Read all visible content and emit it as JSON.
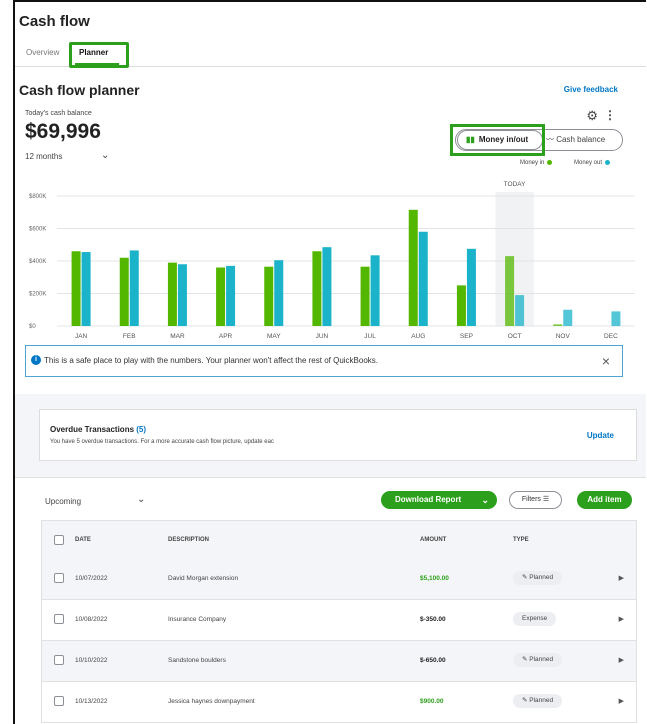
{
  "page": {
    "title": "Cash flow"
  },
  "tabs": [
    {
      "label": "Overview"
    },
    {
      "label": "Planner"
    }
  ],
  "planner": {
    "title": "Cash flow planner",
    "feedback": "Give feedback",
    "balance_label": "Today's cash balance",
    "balance": "$69,996",
    "period": "12 months"
  },
  "toggle": {
    "money_in_out": "Money in/out",
    "cash_balance": "Cash balance"
  },
  "legend": {
    "money_in": "Money in",
    "money_out": "Money out"
  },
  "colors": {
    "money_in": "#53b700",
    "money_out": "#1ab3c9",
    "accent": "#2ca01c",
    "link": "#0077c5"
  },
  "chart_data": {
    "type": "bar",
    "categories": [
      "JAN",
      "FEB",
      "MAR",
      "APR",
      "MAY",
      "JUN",
      "JUL",
      "AUG",
      "SEP",
      "OCT",
      "NOV",
      "DEC"
    ],
    "series": [
      {
        "name": "Money in",
        "values": [
          460000,
          420000,
          390000,
          360000,
          365000,
          460000,
          365000,
          715000,
          250000,
          430000,
          10000,
          0
        ]
      },
      {
        "name": "Money out",
        "values": [
          455000,
          465000,
          380000,
          370000,
          405000,
          485000,
          435000,
          580000,
          475000,
          190000,
          100000,
          90000
        ]
      }
    ],
    "yticks": [
      "$0",
      "$200K",
      "$400K",
      "$600K",
      "$800K"
    ],
    "ylim": [
      0,
      800000
    ],
    "today_label": "TODAY",
    "today_index": 9,
    "grid": true
  },
  "info": {
    "text": "This is a safe place to play with the numbers. Your planner won't affect the rest of QuickBooks."
  },
  "overdue": {
    "title": "Overdue Transactions",
    "count": "(5)",
    "subtitle": "You have 5 overdue transactions. For a more accurate cash flow picture, update eac",
    "action": "Update"
  },
  "toolbar": {
    "filter_value": "Upcoming",
    "download": "Download Report",
    "filters": "Filters",
    "add": "Add item"
  },
  "table": {
    "headers": {
      "date": "DATE",
      "description": "DESCRIPTION",
      "amount": "AMOUNT",
      "type": "TYPE"
    },
    "rows": [
      {
        "date": "10/07/2022",
        "description": "David Morgan extension",
        "amount": "$5,100.00",
        "type": "Planned"
      },
      {
        "date": "10/08/2022",
        "description": "Insurance Company",
        "amount": "$-350.00",
        "type": "Expense"
      },
      {
        "date": "10/10/2022",
        "description": "Sandstone boulders",
        "amount": "$-650.00",
        "type": "Planned"
      },
      {
        "date": "10/13/2022",
        "description": "Jessica haynes downpayment",
        "amount": "$900.00",
        "type": "Planned"
      }
    ]
  }
}
